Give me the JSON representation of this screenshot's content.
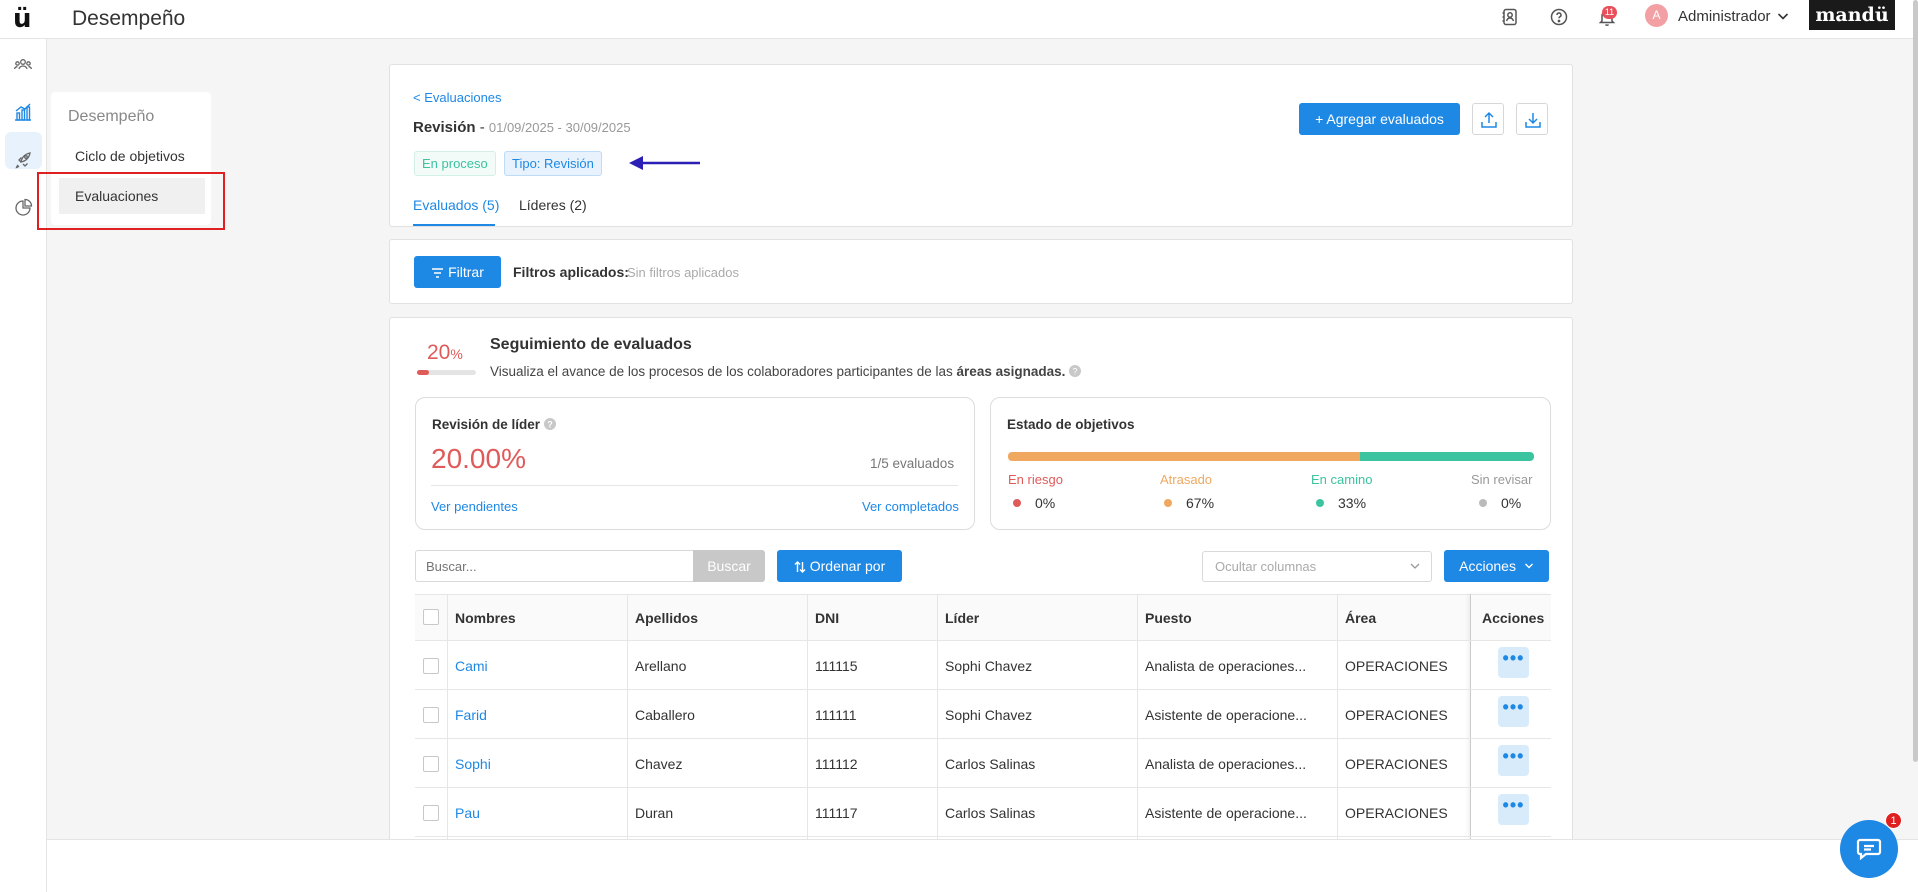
{
  "app": {
    "logo": "ü",
    "title": "Desempeño",
    "brand": "mandü",
    "notifications_count": "11",
    "user_initial": "A",
    "user_name": "Administrador"
  },
  "icons": {
    "rail": [
      "users-icon",
      "chart-bar-icon",
      "rocket-icon",
      "pie-chart-icon"
    ],
    "top": [
      "contacts-icon",
      "help-icon",
      "bell-icon"
    ]
  },
  "colors": {
    "accent": "#1e88e5",
    "danger": "#e05a5a",
    "warning": "#f0a860",
    "success": "#3cc39f",
    "neutral": "#bbbbbb",
    "annotation_arrow": "#2c1fb5",
    "highlight_box": "#e02020"
  },
  "submenu": {
    "title": "Desempeño",
    "items": [
      {
        "label": "Ciclo de objetivos"
      },
      {
        "label": "Evaluaciones"
      }
    ]
  },
  "header": {
    "back_link": "< Evaluaciones",
    "title": "Revisión",
    "title_sep": "-",
    "date_range": "01/09/2025 - 30/09/2025",
    "status_tag": "En proceso",
    "type_tag": "Tipo: Revisión",
    "add_button": "+ Agregar evaluados",
    "tabs": [
      {
        "label": "Evaluados (5)"
      },
      {
        "label": "Líderes (2)"
      }
    ]
  },
  "filters": {
    "button": "Filtrar",
    "applied_label": "Filtros aplicados:",
    "applied_value": "Sin filtros aplicados"
  },
  "tracking": {
    "percent": "20",
    "percent_sign": "%",
    "progress": 0.2,
    "title": "Seguimiento de evaluados",
    "description": "Visualiza el avance de los procesos de los colaboradores participantes de las",
    "description_bold": "áreas asignadas."
  },
  "leader_review": {
    "title": "Revisión de líder",
    "value": "20.00%",
    "count": "1/5 evaluados",
    "pending_link": "Ver pendientes",
    "completed_link": "Ver completados"
  },
  "objectives_state": {
    "title": "Estado de objetivos",
    "bar": [
      {
        "share": 0.67
      },
      {
        "share": 0.33
      }
    ],
    "items": [
      {
        "label": "En riesgo",
        "value": "0%"
      },
      {
        "label": "Atrasado",
        "value": "67%"
      },
      {
        "label": "En camino",
        "value": "33%"
      },
      {
        "label": "Sin revisar",
        "value": "0%"
      }
    ]
  },
  "toolbar": {
    "search_placeholder": "Buscar...",
    "search_button": "Buscar",
    "sort_button": "Ordenar por",
    "hide_columns_placeholder": "Ocultar columnas",
    "actions_button": "Acciones"
  },
  "table": {
    "headers": [
      "Nombres",
      "Apellidos",
      "DNI",
      "Líder",
      "Puesto",
      "Área",
      "Acciones"
    ],
    "rows": [
      {
        "nombre": "Cami",
        "apellido": "Arellano",
        "dni": "111115",
        "lider": "Sophi Chavez",
        "puesto": "Analista de operaciones...",
        "area": "OPERACIONES"
      },
      {
        "nombre": "Farid",
        "apellido": "Caballero",
        "dni": "111111",
        "lider": "Sophi Chavez",
        "puesto": "Asistente de operacione...",
        "area": "OPERACIONES"
      },
      {
        "nombre": "Sophi",
        "apellido": "Chavez",
        "dni": "111112",
        "lider": "Carlos Salinas",
        "puesto": "Analista de operaciones...",
        "area": "OPERACIONES"
      },
      {
        "nombre": "Pau",
        "apellido": "Duran",
        "dni": "111117",
        "lider": "Carlos Salinas",
        "puesto": "Asistente de operacione...",
        "area": "OPERACIONES"
      }
    ],
    "more_label": "•••"
  },
  "chat": {
    "badge": "1"
  }
}
